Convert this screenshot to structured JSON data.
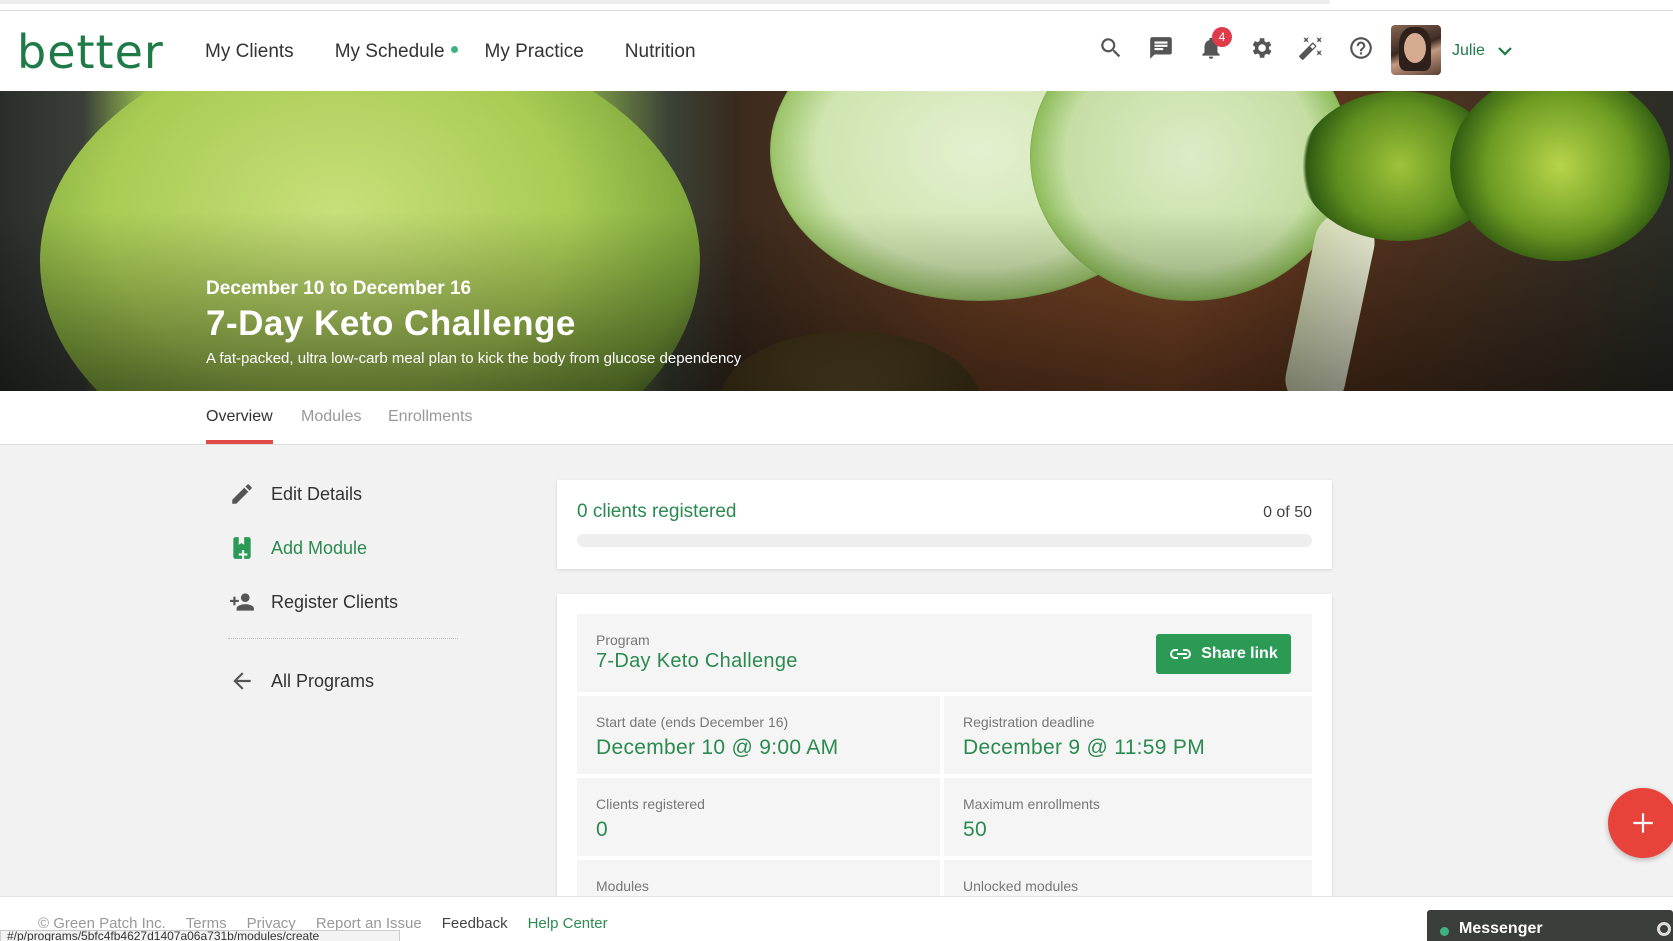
{
  "brand": "better",
  "nav": {
    "links": [
      "My Clients",
      "My Schedule",
      "My Practice",
      "Nutrition"
    ],
    "schedule_dot_color": "#3fb37f",
    "icons": [
      "search-icon",
      "chat-icon",
      "bell-icon",
      "gear-icon",
      "magic-wand-icon",
      "help-icon"
    ],
    "notification_count": "4",
    "user_name": "Julie"
  },
  "hero": {
    "dates": "December 10 to December 16",
    "title": "7-Day Keto Challenge",
    "subtitle": "A fat-packed, ultra low-carb meal plan to kick the body from glucose dependency"
  },
  "tabs": [
    "Overview",
    "Modules",
    "Enrollments"
  ],
  "active_tab": "Overview",
  "sidebar": {
    "items": [
      {
        "label": "Edit Details",
        "icon": "pencil-icon"
      },
      {
        "label": "Add Module",
        "icon": "add-module-icon"
      },
      {
        "label": "Register Clients",
        "icon": "add-person-icon"
      },
      {
        "label": "All Programs",
        "icon": "arrow-left-icon"
      }
    ]
  },
  "registration": {
    "summary": "0 clients registered",
    "count_text": "0 of 50",
    "progress": 0
  },
  "details": {
    "program_label": "Program",
    "program_value": "7-Day Keto Challenge",
    "share_label": "Share link",
    "start_label": "Start date (ends December 16)",
    "start_value": "December 10 @ 9:00 AM",
    "deadline_label": "Registration deadline",
    "deadline_value": "December 9 @ 11:59 PM",
    "clients_label": "Clients registered",
    "clients_value": "0",
    "max_label": "Maximum enrollments",
    "max_value": "50",
    "modules_label": "Modules",
    "unlocked_label": "Unlocked modules"
  },
  "footer": {
    "links": [
      "© Green Patch Inc.",
      "Terms",
      "Privacy",
      "Report an Issue",
      "Feedback",
      "Help Center"
    ],
    "status_url": "#/p/programs/5bfc4fb4627d1407a06a731b/modules/create",
    "messenger": "Messenger"
  },
  "colors": {
    "brand_green": "#1e7a46",
    "accent_green": "#2b9a55",
    "tab_underline": "#e04b45",
    "fab_red": "#e8433b",
    "badge_red": "#e03b4a"
  }
}
